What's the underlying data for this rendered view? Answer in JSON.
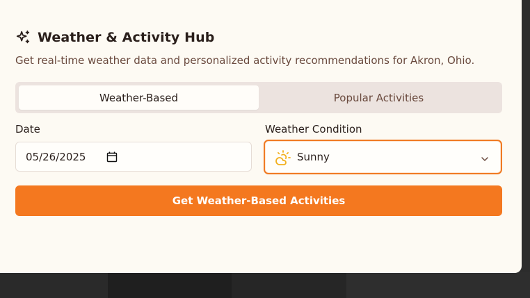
{
  "header": {
    "icon": "sparkles-icon",
    "title": "Weather & Activity Hub",
    "subtitle": "Get real-time weather data and personalized activity recommendations for Akron, Ohio."
  },
  "tabs": [
    {
      "label": "Weather-Based",
      "active": true
    },
    {
      "label": "Popular Activities",
      "active": false
    }
  ],
  "form": {
    "date_label": "Date",
    "date_value": "05/26/2025",
    "date_icon": "calendar-icon",
    "weather_label": "Weather Condition",
    "weather_value": "Sunny",
    "weather_icon": "sun-cloud-icon",
    "dropdown_icon": "chevron-down-icon"
  },
  "actions": {
    "submit_label": "Get Weather-Based Activities"
  },
  "colors": {
    "accent": "#f4781f",
    "background": "#fdfaf3",
    "tab_track": "#ece3df",
    "text_primary": "#2a1f1b",
    "text_secondary": "#6a4a3e",
    "weather_icon": "#f2b01e"
  }
}
